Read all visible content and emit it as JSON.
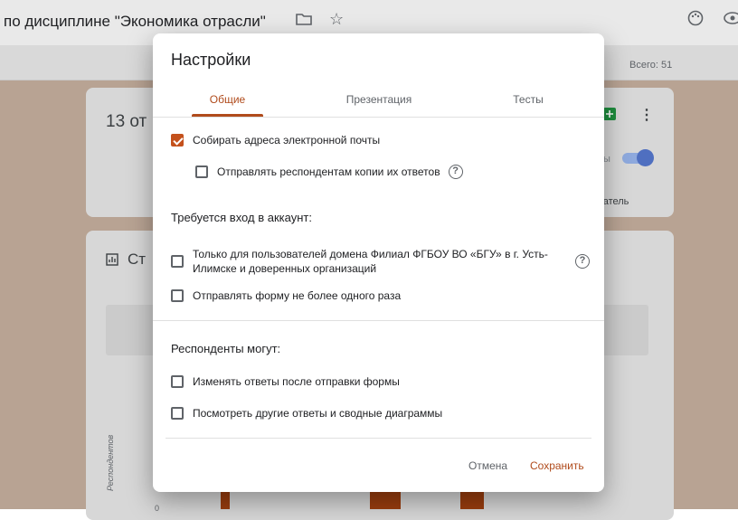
{
  "app": {
    "doc_title": "по дисциплине \"Экономика отрасли\"",
    "total_label": "Всего: 51",
    "bg_card_heading": "13 от",
    "bg_summary_label": "Ст",
    "bg_user_label": "ватель",
    "bg_toggle_text": "ы",
    "bg_axis_label": "Респондентов",
    "bg_axis_zero": "0"
  },
  "dialog": {
    "title": "Настройки",
    "tabs": [
      {
        "label": "Общие",
        "active": true
      },
      {
        "label": "Презентация",
        "active": false
      },
      {
        "label": "Тесты",
        "active": false
      }
    ],
    "general": {
      "collect_emails": {
        "label": "Собирать адреса электронной почты",
        "checked": true
      },
      "send_copies": {
        "label": "Отправлять респондентам копии их ответов",
        "checked": false
      },
      "login_heading": "Требуется вход в аккаунт:",
      "domain_only": {
        "label": "Только для пользователей домена Филиал ФГБОУ ВО «БГУ» в г. Усть-Илимске и доверенных организаций",
        "checked": false
      },
      "limit_one": {
        "label": "Отправлять форму не более одного раза",
        "checked": false
      },
      "respondents_heading": "Респонденты могут:",
      "edit_after": {
        "label": "Изменять ответы после отправки формы",
        "checked": false
      },
      "see_summary": {
        "label": "Посмотреть другие ответы и сводные диаграммы",
        "checked": false
      }
    },
    "buttons": {
      "cancel": "Отмена",
      "save": "Сохранить"
    }
  },
  "colors": {
    "accent": "#b04b1c",
    "checkbox_checked": "#c4511c",
    "background_overlay": "#b8a393"
  },
  "icons": [
    "folder-icon",
    "star-icon",
    "palette-icon",
    "eye-icon",
    "sheets-icon",
    "more-vert-icon",
    "chart-icon",
    "help-icon"
  ]
}
